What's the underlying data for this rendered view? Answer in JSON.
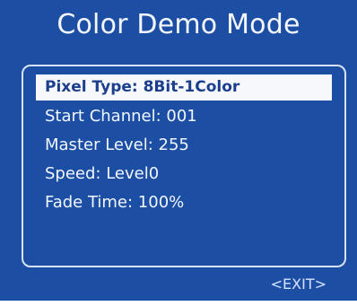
{
  "title": "Color Demo Mode",
  "menu": {
    "items": [
      {
        "label": "Pixel Type: 8Bit-1Color",
        "selected": true
      },
      {
        "label": "Start Channel: 001",
        "selected": false
      },
      {
        "label": "Master Level: 255",
        "selected": false
      },
      {
        "label": "Speed: Level0",
        "selected": false
      },
      {
        "label": "Fade Time: 100%",
        "selected": false
      }
    ]
  },
  "footer": {
    "exit_label": "<EXIT>"
  },
  "colors": {
    "background": "#1c4fa3",
    "highlight": "#f7f8fb",
    "highlight_text": "#1b3f8d",
    "text": "#f2f6ff"
  }
}
